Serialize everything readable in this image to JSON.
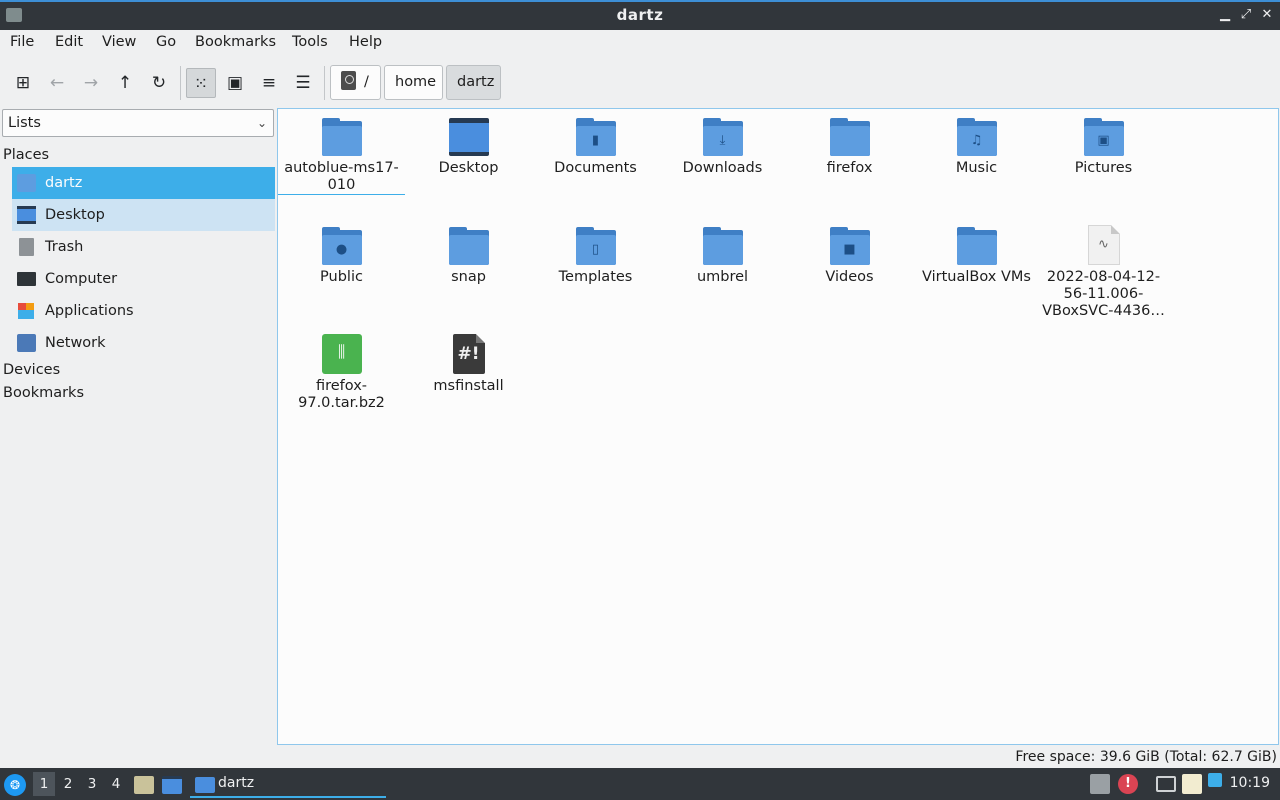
{
  "window": {
    "title": "dartz"
  },
  "menubar": [
    "File",
    "Edit",
    "View",
    "Go",
    "Bookmarks",
    "Tools",
    "Help"
  ],
  "toolbar": {
    "icons": [
      "new-window-icon",
      "back-arrow-icon",
      "forward-arrow-icon",
      "up-arrow-icon",
      "reload-icon",
      "icon-view-icon",
      "thumbnail-view-icon",
      "compact-view-icon",
      "detailed-list-view-icon"
    ],
    "breadcrumbs": [
      "/",
      "home",
      "dartz"
    ]
  },
  "sidebar": {
    "mode": "Lists",
    "places_header": "Places",
    "places": [
      {
        "label": "dartz",
        "icon": "home-folder-icon"
      },
      {
        "label": "Desktop",
        "icon": "desktop-icon"
      },
      {
        "label": "Trash",
        "icon": "trash-icon"
      },
      {
        "label": "Computer",
        "icon": "computer-icon"
      },
      {
        "label": "Applications",
        "icon": "applications-icon"
      },
      {
        "label": "Network",
        "icon": "network-icon"
      }
    ],
    "devices_header": "Devices",
    "bookmarks_header": "Bookmarks"
  },
  "files": [
    {
      "name": "autoblue-ms17-010",
      "type": "folder"
    },
    {
      "name": "Desktop",
      "type": "desktop"
    },
    {
      "name": "Documents",
      "type": "folder",
      "icon": "document-icon"
    },
    {
      "name": "Downloads",
      "type": "folder",
      "icon": "download-icon"
    },
    {
      "name": "firefox",
      "type": "folder"
    },
    {
      "name": "Music",
      "type": "folder",
      "icon": "music-note-icon"
    },
    {
      "name": "Pictures",
      "type": "folder",
      "icon": "picture-icon"
    },
    {
      "name": "Public",
      "type": "folder",
      "icon": "user-icon"
    },
    {
      "name": "snap",
      "type": "folder"
    },
    {
      "name": "Templates",
      "type": "folder",
      "icon": "template-icon"
    },
    {
      "name": "umbrel",
      "type": "folder"
    },
    {
      "name": "Videos",
      "type": "folder",
      "icon": "video-camera-icon"
    },
    {
      "name": "VirtualBox VMs",
      "type": "folder"
    },
    {
      "name": "2022-08-04-12-56-11.006-VBoxSVC-4436…",
      "type": "log-file"
    },
    {
      "name": "firefox-97.0.tar.bz2",
      "type": "archive"
    },
    {
      "name": "msfinstall",
      "type": "script"
    }
  ],
  "status": {
    "free_space": "Free space: 39.6 GiB (Total: 62.7 GiB)"
  },
  "taskbar": {
    "workspaces": [
      "1",
      "2",
      "3",
      "4"
    ],
    "active_task": "dartz",
    "clock": "10:19"
  }
}
